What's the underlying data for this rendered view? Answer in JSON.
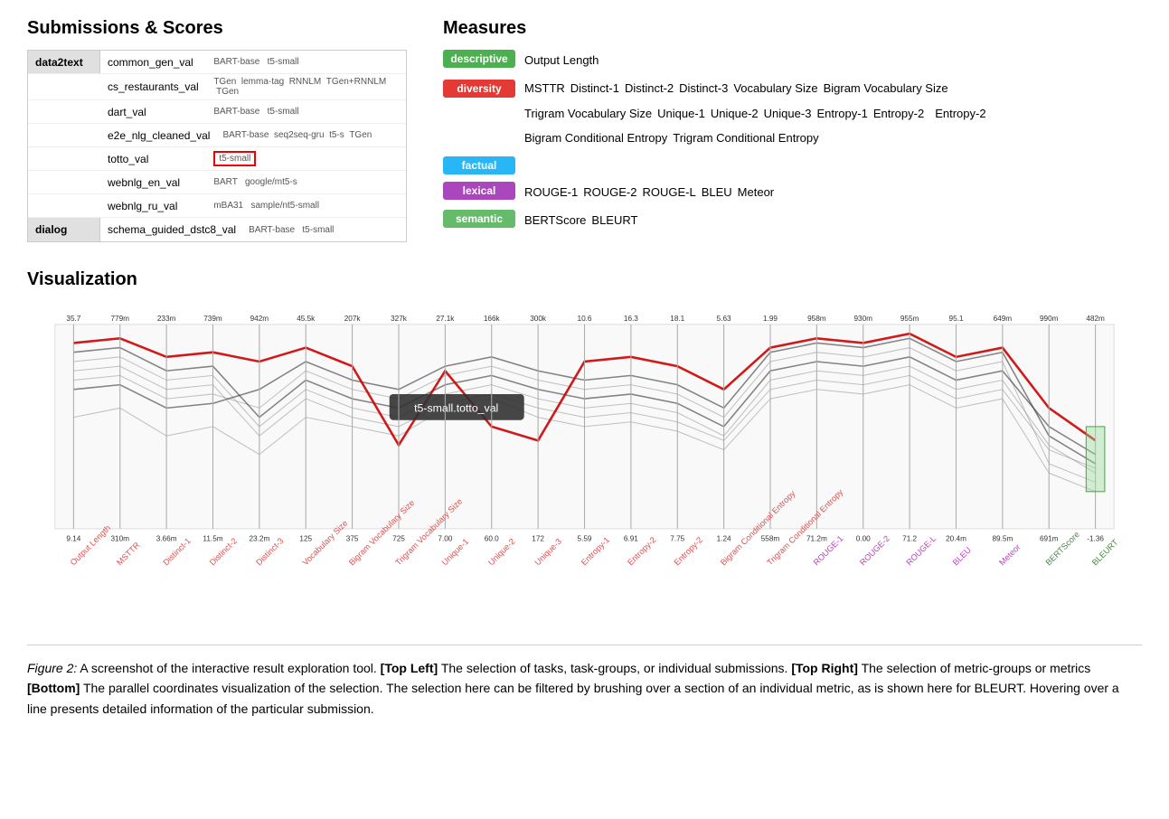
{
  "submissions": {
    "title": "Submissions & Scores",
    "groups": [
      {
        "group": "data2text",
        "entries": [
          {
            "name": "common_gen_val",
            "models": "BART-base  t5-small"
          },
          {
            "name": "cs_restaurants_val",
            "models": "TGen  lemma-tag  RNNLM  TGen+RNNLM  TGen"
          },
          {
            "name": "dart_val",
            "models": "BART-base  t5-small"
          },
          {
            "name": "e2e_nlg_cleaned_val",
            "models": "BART-base  seq2seq-gru  t5-s  TGen"
          },
          {
            "name": "totto_val",
            "models": "t5-small",
            "highlight": true
          },
          {
            "name": "webnlg_en_val",
            "models": "BART  google/mt5-s"
          },
          {
            "name": "webnlg_ru_val",
            "models": "mBA31  sample/nt5-small"
          }
        ]
      },
      {
        "group": "dialog",
        "entries": [
          {
            "name": "schema_guided_dstc8_val",
            "models": "BART-base  t5-small"
          }
        ]
      }
    ]
  },
  "measures": {
    "title": "Measures",
    "categories": [
      {
        "name": "descriptive",
        "badge_class": "badge-descriptive",
        "metrics": [
          "Output Length"
        ]
      },
      {
        "name": "diversity",
        "badge_class": "badge-diversity",
        "metrics": [
          "MSTTR",
          "Distinct-1",
          "Distinct-2",
          "Distinct-3",
          "Vocabulary Size",
          "Bigram Vocabulary Size",
          "Trigram Vocabulary Size",
          "Unique-1",
          "Unique-2",
          "Unique-3",
          "Entropy-1",
          "Entropy-2",
          "Entropy-2",
          "Bigram Conditional Entropy",
          "Trigram Conditional Entropy"
        ]
      },
      {
        "name": "factual",
        "badge_class": "badge-factual",
        "metrics": []
      },
      {
        "name": "lexical",
        "badge_class": "badge-lexical",
        "metrics": [
          "ROUGE-1",
          "ROUGE-2",
          "ROUGE-L",
          "BLEU",
          "Meteor"
        ]
      },
      {
        "name": "semantic",
        "badge_class": "badge-semantic",
        "metrics": [
          "BERTScore",
          "BLEURT"
        ]
      }
    ]
  },
  "visualization": {
    "title": "Visualization",
    "tooltip": "t5-small.totto_val",
    "top_values": [
      "35.7",
      "779m",
      "233m",
      "739m",
      "942m",
      "45.5k",
      "207k",
      "327k",
      "27.1k",
      "166k",
      "300k",
      "10.6",
      "16.3",
      "18.1",
      "5.63",
      "1.99",
      "958m",
      "930m",
      "955m",
      "95.1",
      "649m",
      "990m",
      "482m"
    ],
    "bottom_values": [
      "9.14",
      "310m",
      "3.66m",
      "11.5m",
      "23.2m",
      "125",
      "375",
      "725",
      "7.00",
      "60.0",
      "172",
      "5.59",
      "6.91",
      "7.75",
      "1.24",
      "558m",
      "71.2m",
      "0.00",
      "71.2",
      "20.4m",
      "89.5m",
      "691m",
      "-1.36"
    ],
    "axis_labels": [
      "Output Length",
      "MSTTR",
      "Distinct-1",
      "Distinct-2",
      "Distinct-3",
      "Vocabulary Size",
      "Bigram Vocabulary Size",
      "Trigram Vocabulary Size",
      "Unique-1",
      "Unique-2",
      "Unique-3",
      "Entropy-1",
      "Entropy-2",
      "Entropy-2",
      "Bigram Conditional Entropy",
      "Trigram Conditional Entropy",
      "ROUGE-1",
      "ROUGE-2",
      "ROUGE-L",
      "BLEU",
      "Meteor",
      "BERTScore",
      "BLEURT"
    ],
    "axis_colors": [
      "#ff6666",
      "#ff6666",
      "#ff6666",
      "#ff6666",
      "#ff6666",
      "#ff6666",
      "#ff6666",
      "#ff6666",
      "#ff6666",
      "#ff6666",
      "#ff6666",
      "#ff6666",
      "#ff6666",
      "#ff6666",
      "#ff6666",
      "#ff6666",
      "#cc44cc",
      "#cc44cc",
      "#cc44cc",
      "#cc44cc",
      "#cc44cc",
      "#66aa66",
      "#66aa66"
    ]
  },
  "caption": {
    "label": "Figure 2:",
    "text": " A screenshot of the interactive result exploration tool. ",
    "top_left_bold": "[Top Left]",
    "top_left_text": " The selection of tasks, task-groups, or individual submissions. ",
    "top_right_bold": "[Top Right]",
    "top_right_text": " The selection of metric-groups or metrics ",
    "bottom_bold": "[Bottom]",
    "bottom_text": " The parallel coordinates visualization of the selection. The selection here can be filtered by brushing over a section of an individual metric, as is shown here for BLEURT. Hovering over a line presents detailed information of the particular submission."
  }
}
